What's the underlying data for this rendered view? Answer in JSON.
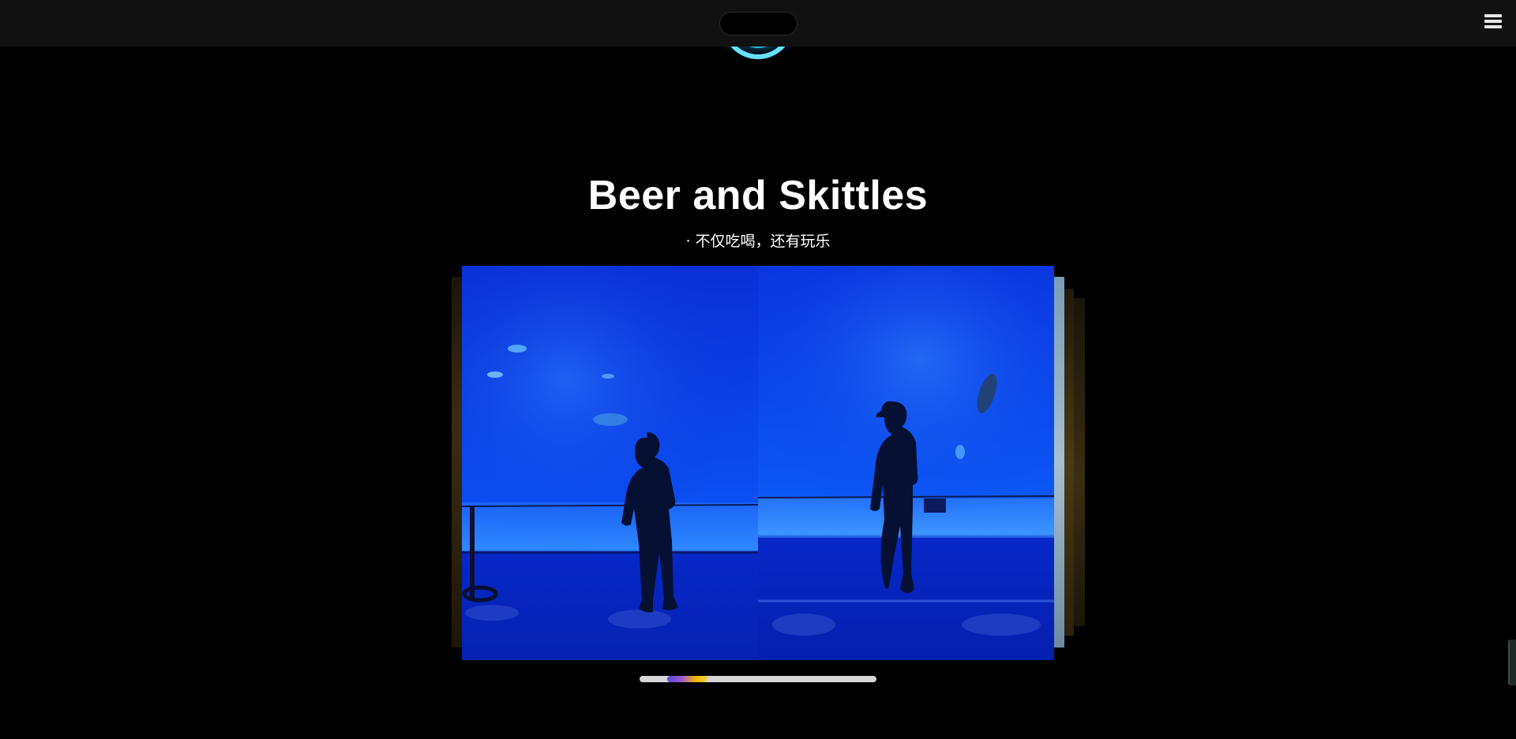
{
  "header": {
    "menu_icon": "hamburger-menu-icon",
    "emblem_icon": "glowing-emblem-icon"
  },
  "hero": {
    "title": "Beer and Skittles",
    "subtitle": "· 不仅吃喝，还有玩乐"
  },
  "carousel": {
    "active_image": "aquarium-silhouettes-photo",
    "progress": 0.2,
    "progress_window": 0.17
  },
  "colors": {
    "background": "#000000",
    "topbar": "#111111",
    "accent_glow": "#1ec8ff",
    "progress_track": "#d6d6d6",
    "progress_purple": "#5b4ad6",
    "progress_gold": "#f0b400"
  }
}
